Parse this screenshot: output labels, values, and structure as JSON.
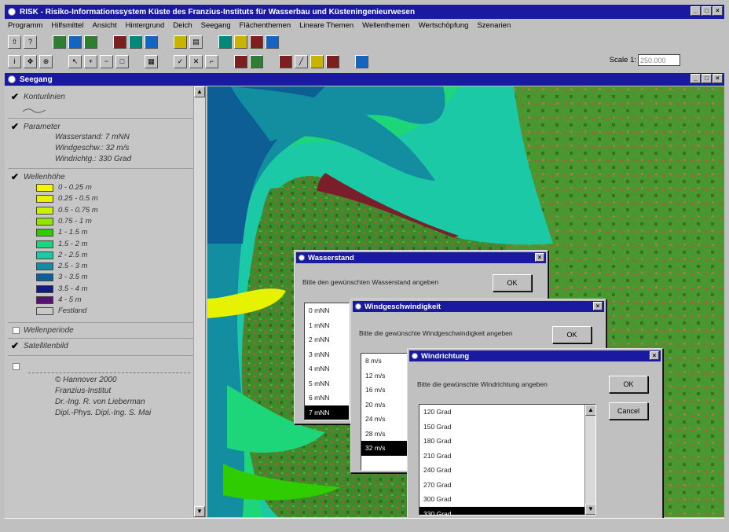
{
  "app": {
    "title": "RISK - Risiko-Informationssystem Küste des Franzius-Instituts für Wasserbau und Küsteningenieurwesen",
    "menu": [
      "Programm",
      "Hilfsmittel",
      "Ansicht",
      "Hintergrund",
      "Deich",
      "Seegang",
      "Flächenthemen",
      "Lineare Themen",
      "Wellenthemen",
      "Wertschöpfung",
      "Szenarien"
    ],
    "scale_label": "Scale 1:",
    "scale_value": "250.000"
  },
  "window": {
    "title": "Seegang"
  },
  "legend": {
    "contours": {
      "label": "Konturlinien",
      "checked": true
    },
    "parameters": {
      "label": "Parameter",
      "checked": true,
      "lines": [
        "Wasserstand: 7 mNN",
        "Windgeschw.: 32 m/s",
        "Windrichtg.: 330 Grad"
      ]
    },
    "wave_height": {
      "label": "Wellenhöhe",
      "checked": true,
      "classes": [
        {
          "label": "0 - 0.25 m",
          "color": "#f5f500"
        },
        {
          "label": "0.25 - 0.5 m",
          "color": "#e6f200"
        },
        {
          "label": "0.5 - 0.75 m",
          "color": "#c8f000"
        },
        {
          "label": "0.75 - 1 m",
          "color": "#8ee600"
        },
        {
          "label": "1 - 1.5 m",
          "color": "#2ecc00"
        },
        {
          "label": "1.5 - 2 m",
          "color": "#1ed67a"
        },
        {
          "label": "2 - 2.5 m",
          "color": "#1cc9a6"
        },
        {
          "label": "2.5 - 3 m",
          "color": "#138ea0"
        },
        {
          "label": "3 - 3.5 m",
          "color": "#0e5e96"
        },
        {
          "label": "3.5 - 4 m",
          "color": "#101a80"
        },
        {
          "label": "4 - 5 m",
          "color": "#5a1070"
        },
        {
          "label": "Festland",
          "color": "#c8c8c8"
        }
      ]
    },
    "wave_period": {
      "label": "Wellenperiode",
      "checked": false
    },
    "satellite": {
      "label": "Satellitenbild",
      "checked": true
    },
    "credits": [
      "© Hannover 2000",
      "Franzius-Institut",
      "Dr.-Ing. R. von Lieberman",
      "Dipl.-Phys. Dipl.-Ing. S. Mai"
    ]
  },
  "dialogs": {
    "water": {
      "title": "Wasserstand",
      "prompt": "Bitte den gewünschten Wasserstand angeben",
      "ok": "OK",
      "items": [
        "0 mNN",
        "1 mNN",
        "2 mNN",
        "3 mNN",
        "4 mNN",
        "5 mNN",
        "6 mNN",
        "7 mNN"
      ],
      "selected": "7 mNN"
    },
    "wind_speed": {
      "title": "Windgeschwindigkeit",
      "prompt": "Bitte die gewünschte Windgeschwindigkeit angeben",
      "ok": "OK",
      "items": [
        "8 m/s",
        "12 m/s",
        "16 m/s",
        "20 m/s",
        "24 m/s",
        "28 m/s",
        "32 m/s"
      ],
      "selected": "32 m/s"
    },
    "wind_dir": {
      "title": "Windrichtung",
      "prompt": "Bitte die gewünschte Windrichtung angeben",
      "ok": "OK",
      "cancel": "Cancel",
      "items": [
        "120 Grad",
        "150 Grad",
        "180 Grad",
        "210 Grad",
        "240 Grad",
        "270 Grad",
        "300 Grad",
        "330 Grad"
      ],
      "selected": "330 Grad"
    }
  }
}
